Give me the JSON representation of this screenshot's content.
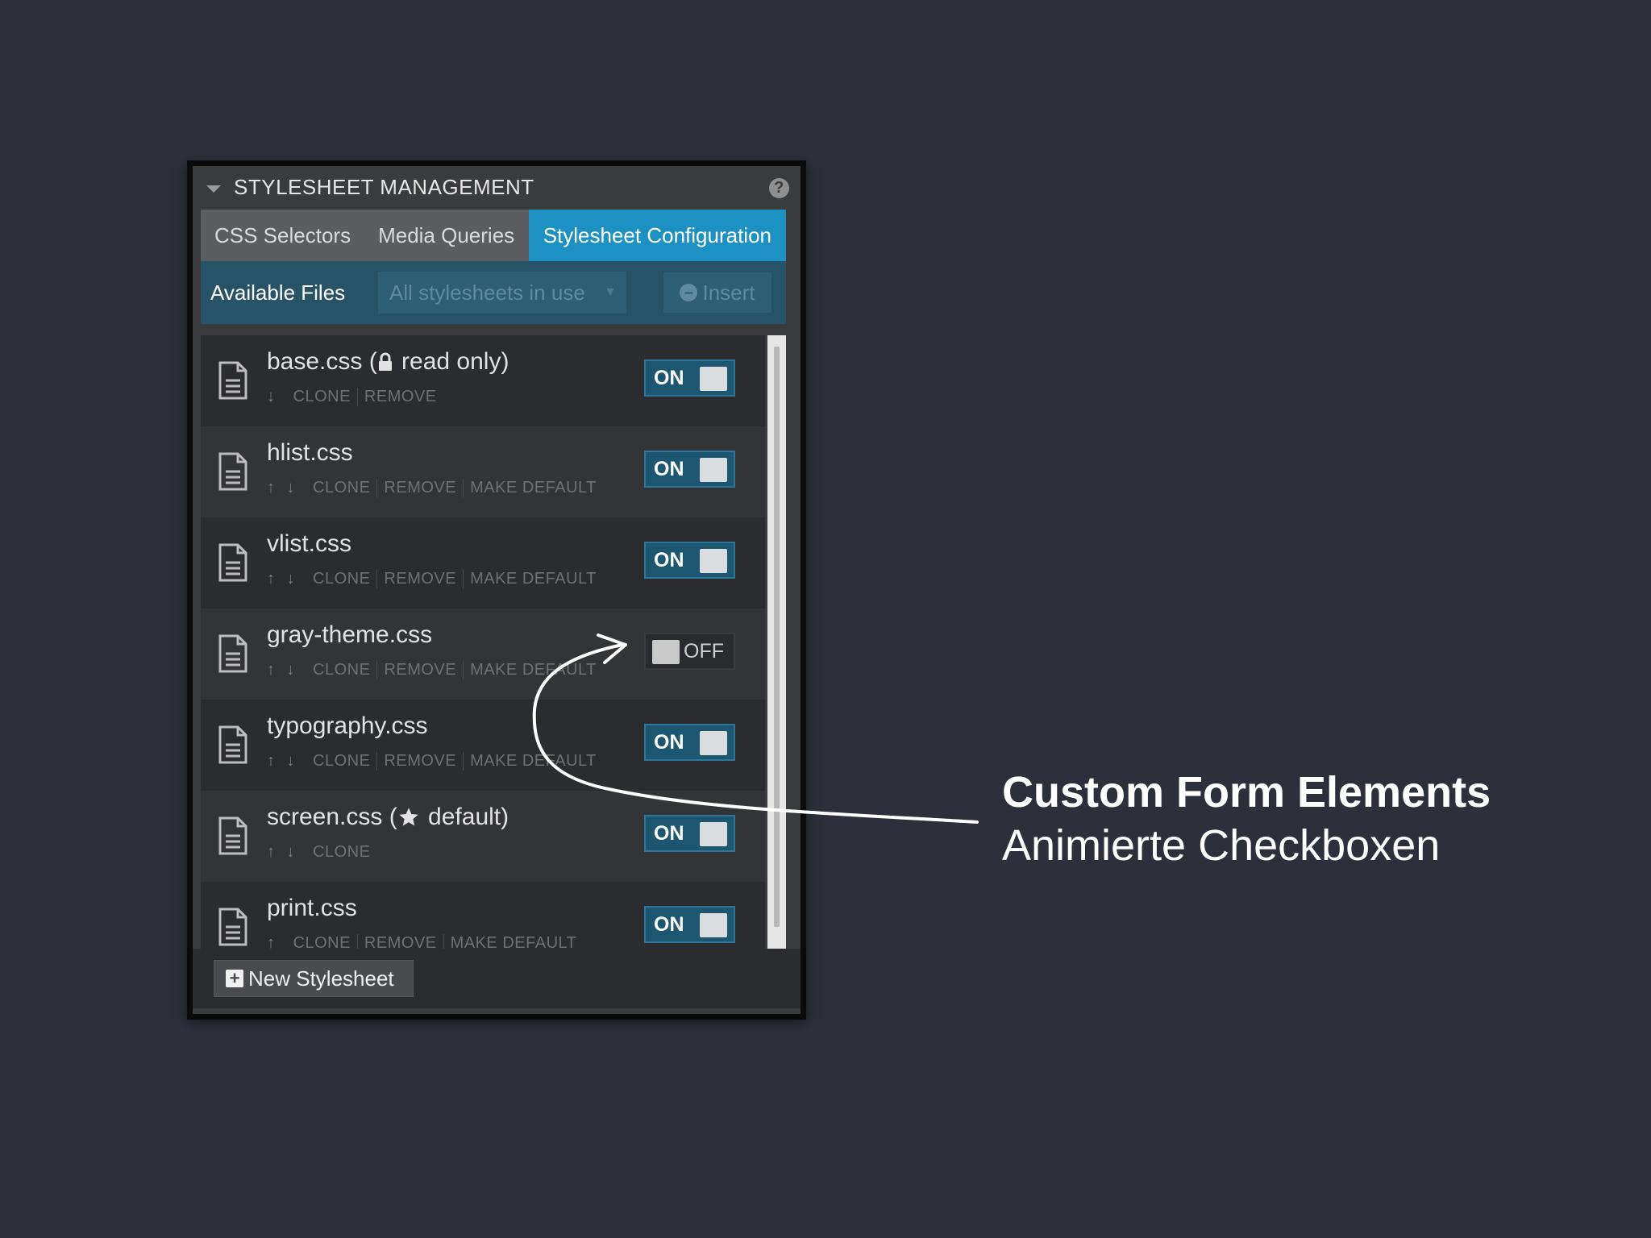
{
  "panel": {
    "title": "STYLESHEET MANAGEMENT",
    "help": "?",
    "tabs": [
      {
        "label": "CSS Selectors",
        "active": false
      },
      {
        "label": "Media Queries",
        "active": false
      },
      {
        "label": "Stylesheet Configuration",
        "active": true
      }
    ],
    "toolbar": {
      "label": "Available Files",
      "select_value": "All stylesheets in use",
      "insert_label": "Insert"
    },
    "files": [
      {
        "name": "base.css",
        "suffix": "read only)",
        "suffix_icon": "lock-icon",
        "arrows": [
          "↓"
        ],
        "actions": [
          "CLONE",
          "REMOVE"
        ],
        "toggle": "ON"
      },
      {
        "name": "hlist.css",
        "arrows": [
          "↑",
          "↓"
        ],
        "actions": [
          "CLONE",
          "REMOVE",
          "MAKE DEFAULT"
        ],
        "toggle": "ON"
      },
      {
        "name": "vlist.css",
        "arrows": [
          "↑",
          "↓"
        ],
        "actions": [
          "CLONE",
          "REMOVE",
          "MAKE DEFAULT"
        ],
        "toggle": "ON"
      },
      {
        "name": "gray-theme.css",
        "arrows": [
          "↑",
          "↓"
        ],
        "actions": [
          "CLONE",
          "REMOVE",
          "MAKE DEFAULT"
        ],
        "toggle": "OFF"
      },
      {
        "name": "typography.css",
        "arrows": [
          "↑",
          "↓"
        ],
        "actions": [
          "CLONE",
          "REMOVE",
          "MAKE DEFAULT"
        ],
        "toggle": "ON"
      },
      {
        "name": "screen.css",
        "suffix": "default)",
        "suffix_icon": "star-icon",
        "arrows": [
          "↑",
          "↓"
        ],
        "actions": [
          "CLONE"
        ],
        "toggle": "ON"
      },
      {
        "name": "print.css",
        "arrows": [
          "↑"
        ],
        "actions": [
          "CLONE",
          "REMOVE",
          "MAKE DEFAULT"
        ],
        "toggle": "ON"
      }
    ],
    "new_button": "New Stylesheet"
  },
  "annotation": {
    "title": "Custom Form Elements",
    "subtitle": "Animierte Checkboxen"
  },
  "colors": {
    "background": "#2d303b",
    "accent": "#1d91c3",
    "toggle_on": "#1c5671"
  }
}
